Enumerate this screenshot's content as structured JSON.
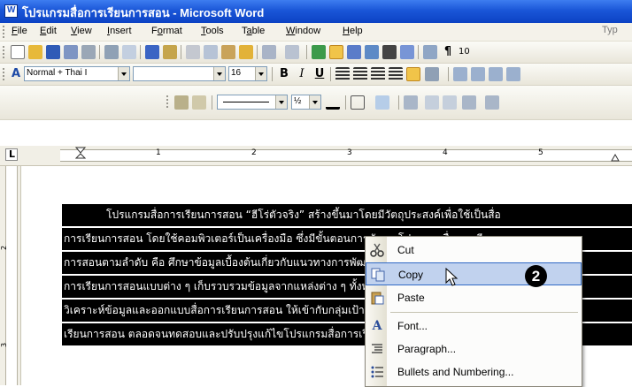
{
  "window": {
    "title": "โปรแกรมสื่อการเรียนการสอน - Microsoft Word"
  },
  "menubar": {
    "items": [
      {
        "label": "File",
        "key": "F"
      },
      {
        "label": "Edit",
        "key": "E"
      },
      {
        "label": "View",
        "key": "V"
      },
      {
        "label": "Insert",
        "key": "I"
      },
      {
        "label": "Format",
        "key": "o"
      },
      {
        "label": "Tools",
        "key": "T"
      },
      {
        "label": "Table",
        "key": "a"
      },
      {
        "label": "Window",
        "key": "W"
      },
      {
        "label": "Help",
        "key": "H"
      }
    ],
    "type_question": "Typ"
  },
  "formatting": {
    "style": "Normal + Thai I",
    "font_size": "16",
    "zoom_partial": "10",
    "half_label": "½"
  },
  "ruler": {
    "numbers": [
      "1",
      "2",
      "3",
      "4",
      "5"
    ]
  },
  "vruler": {
    "numbers": [
      "2",
      "3"
    ]
  },
  "document": {
    "lines": [
      "โปรแกรมสื่อการเรียนการสอน “ฮีโร่ตัวจริง” สร้างขึ้นมาโดยมีวัตถุประสงค์เพื่อใช้เป็นสื่อ",
      "การเรียนการสอน โดยใช้คอมพิวเตอร์เป็นเครื่องมือ ซึ่งมีขั้นตอนการพัฒนาโปรแกรมสื่อการเรียน",
      "การสอนตามลำดับ คือ ศึกษาข้อมูลเบื้องต้นเกี่ยวกับแนวทางการพัฒนาโปรแกรมสื่อ",
      "การเรียนการสอนแบบต่าง ๆ เก็บรวบรวมข้อมูลจากแหล่งต่าง ๆ ทั้งหนังสือ และเว็บไซต์",
      "วิเคราะห์ข้อมูลและออกแบบสื่อการเรียนการสอน ให้เข้ากับกลุ่มเป้าหมายของสื่อการ",
      "เรียนการสอน ตลอดจนทดสอบและปรับปรุงแก้ไขโปรแกรมสื่อการเรียนการสอนให้สมบูรณ์"
    ]
  },
  "context_menu": {
    "items": [
      {
        "label": "Cut",
        "icon": "scissors-icon"
      },
      {
        "label": "Copy",
        "icon": "copy-icon",
        "highlighted": true
      },
      {
        "label": "Paste",
        "icon": "paste-icon"
      },
      {
        "label": "Font...",
        "icon": "font-icon"
      },
      {
        "label": "Paragraph...",
        "icon": "paragraph-icon"
      },
      {
        "label": "Bullets and Numbering...",
        "icon": "bullets-icon"
      }
    ]
  },
  "annotation": {
    "step": "2"
  }
}
